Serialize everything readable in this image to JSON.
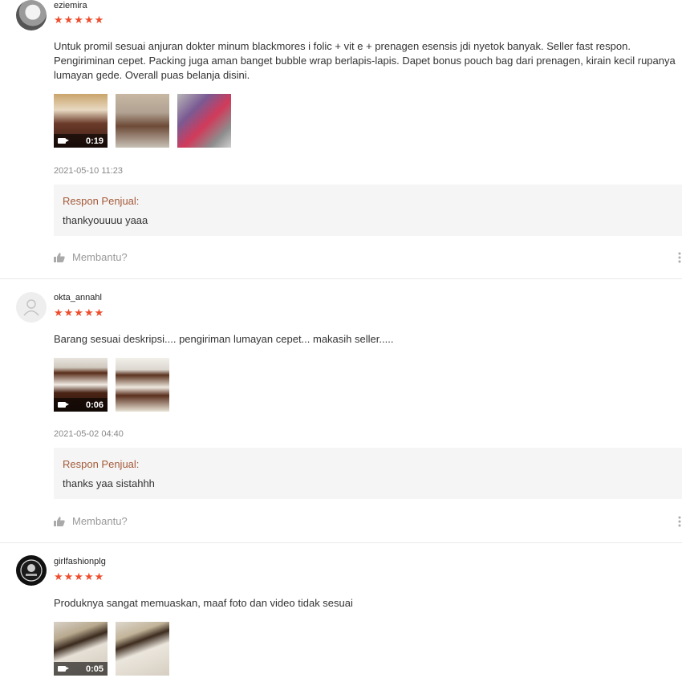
{
  "reviews": [
    {
      "username": "eziemira",
      "stars": "★★★★★",
      "comment": "Untuk promil sesuai anjuran dokter minum blackmores i folic + vit e + prenagen esensis jdi nyetok banyak. Seller fast respon. Pengiriminan cepet. Packing juga aman banget bubble wrap berlapis-lapis. Dapet bonus pouch bag dari prenagen, kirain kecil rupanya lumayan gede. Overall puas belanja disini.",
      "video_duration": "0:19",
      "date": "2021-05-10 11:23",
      "response_label": "Respon Penjual:",
      "response_text": "thankyouuuu yaaa",
      "helpful_label": "Membantu?"
    },
    {
      "username": "okta_annahl",
      "stars": "★★★★★",
      "comment": "Barang sesuai deskripsi.... pengiriman lumayan cepet... makasih seller.....",
      "video_duration": "0:06",
      "date": "2021-05-02 04:40",
      "response_label": "Respon Penjual:",
      "response_text": "thanks yaa sistahhh",
      "helpful_label": "Membantu?"
    },
    {
      "username": "girlfashionplg",
      "stars": "★★★★★",
      "comment": "Produknya sangat memuaskan, maaf foto dan video tidak sesuai",
      "video_duration": "0:05"
    }
  ],
  "colors": {
    "star": "#ee4d2d",
    "response_label": "#a45a3a",
    "response_bg": "#f5f5f5",
    "muted": "#999999"
  },
  "icons": [
    "camera-icon",
    "thumbs-up-icon",
    "more-options-icon",
    "default-avatar-icon"
  ]
}
